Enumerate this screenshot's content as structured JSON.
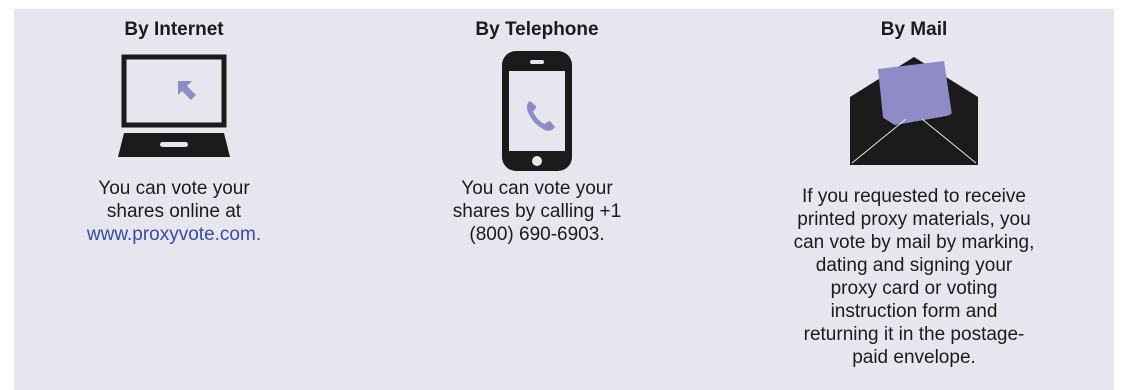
{
  "colors": {
    "panel_bg": "#e6e6ee",
    "icon_dark": "#1b1b1b",
    "accent_purple": "#8f8bc8",
    "link_blue": "#3a4aa0"
  },
  "methods": [
    {
      "title": "By Internet",
      "icon": "laptop-icon",
      "text_before": "You can vote your shares online at",
      "link": "www.proxyvote.com."
    },
    {
      "title": "By Telephone",
      "icon": "phone-icon",
      "text": "You can vote your shares by calling +1 (800) 690-6903."
    },
    {
      "title": "By Mail",
      "icon": "envelope-icon",
      "text": "If you requested to receive printed proxy materials, you can vote by mail by marking, dating and signing your proxy card or voting instruction form and returning it in the postage-paid envelope."
    }
  ]
}
